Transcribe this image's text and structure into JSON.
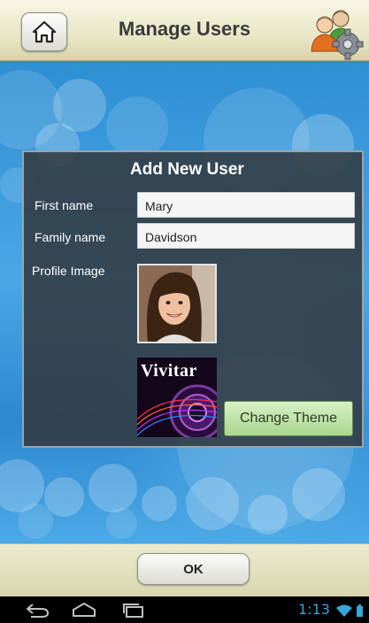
{
  "header": {
    "title": "Manage Users"
  },
  "panel": {
    "title": "Add New User",
    "first_name_label": "First name",
    "family_name_label": "Family name",
    "profile_image_label": "Profile Image",
    "first_name_value": "Mary",
    "family_name_value": "Davidson",
    "theme_thumbnail_text": "Vivitar",
    "change_theme_label": "Change Theme"
  },
  "footer": {
    "ok_label": "OK"
  },
  "status_bar": {
    "time": "1:13"
  },
  "colors": {
    "accent_green": "#a9d78d",
    "clock_blue": "#35a6d8"
  }
}
